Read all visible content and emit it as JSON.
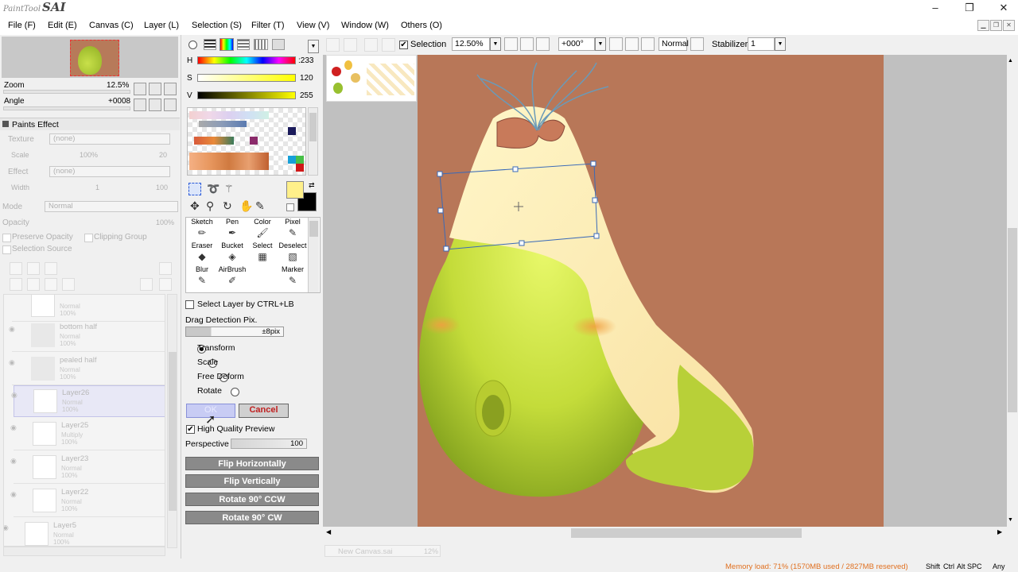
{
  "app": {
    "logo_small": "PaintTool",
    "logo_big": "SAI",
    "window_min": "–",
    "window_restore": "❐",
    "window_close": "✕"
  },
  "menu": [
    "File (F)",
    "Edit (E)",
    "Canvas (C)",
    "Layer (L)",
    "Selection (S)",
    "Filter (T)",
    "View (V)",
    "Window (W)",
    "Others (O)"
  ],
  "navigator": {
    "zoom_label": "Zoom",
    "zoom_value": "12.5%",
    "angle_label": "Angle",
    "angle_value": "+0008"
  },
  "paints_effect": {
    "header": "Paints Effect",
    "texture_label": "Texture",
    "texture_value": "(none)",
    "scale_label": "Scale",
    "scale_value": "100%",
    "scale_num": "20",
    "effect_label": "Effect",
    "effect_value": "(none)",
    "width_label": "Width",
    "width_value": "1",
    "width_num": "100",
    "mode_label": "Mode",
    "mode_value": "Normal",
    "opacity_label": "Opacity",
    "opacity_value": "100%",
    "preserve_opacity": "Preserve Opacity",
    "clipping_group": "Clipping Group",
    "selection_source": "Selection Source"
  },
  "layers": [
    {
      "name": "",
      "mode": "Normal",
      "opacity": "100%"
    },
    {
      "name": "bottom half",
      "mode": "Normal",
      "opacity": "100%"
    },
    {
      "name": "pealed half",
      "mode": "Normal",
      "opacity": "100%"
    },
    {
      "name": "Layer26",
      "mode": "Normal",
      "opacity": "100%"
    },
    {
      "name": "Layer25",
      "mode": "Multiply",
      "opacity": "100%"
    },
    {
      "name": "Layer23",
      "mode": "Normal",
      "opacity": "100%"
    },
    {
      "name": "Layer22",
      "mode": "Normal",
      "opacity": "100%"
    },
    {
      "name": "Layer5",
      "mode": "Normal",
      "opacity": "100%"
    }
  ],
  "color": {
    "h_label": "H",
    "h_value": ":233",
    "s_label": "S",
    "s_value": "120",
    "v_label": "V",
    "v_value": "255",
    "fg": "#fff08a",
    "bg": "#000000"
  },
  "tools": [
    {
      "label": "Sketch",
      "icon": "pencil-icon"
    },
    {
      "label": "Pen",
      "icon": "pen-icon"
    },
    {
      "label": "Color",
      "icon": "brush-icon"
    },
    {
      "label": "Pixel",
      "icon": "pixel-pen-icon"
    },
    {
      "label": "Eraser",
      "icon": "eraser-icon"
    },
    {
      "label": "Bucket",
      "icon": "bucket-icon"
    },
    {
      "label": "Select",
      "icon": "select-icon"
    },
    {
      "label": "Deselect",
      "icon": "deselect-icon"
    },
    {
      "label": "Blur",
      "icon": "blur-icon"
    },
    {
      "label": "AirBrush",
      "icon": "airbrush-icon"
    },
    {
      "label": "",
      "icon": ""
    },
    {
      "label": "Marker",
      "icon": "marker-icon"
    }
  ],
  "transform": {
    "select_layer_ctrl": "Select Layer by CTRL+LB",
    "drag_detection": "Drag Detection Pix.",
    "drag_value": "±8pix",
    "opt_transform": "Transform",
    "opt_scale": "Scale",
    "opt_free": "Free Deform",
    "opt_rotate": "Rotate",
    "ok": "OK",
    "cancel": "Cancel",
    "hq_preview": "High Quality Preview",
    "perspective": "Perspective",
    "perspective_value": "100",
    "flip_h": "Flip Horizontally",
    "flip_v": "Flip Vertically",
    "rot_ccw": "Rotate 90° CCW",
    "rot_cw": "Rotate 90° CW"
  },
  "options": {
    "selection_label": "Selection",
    "zoom": "12.50%",
    "angle": "+000°",
    "blend": "Normal",
    "stabilizer_label": "Stabilizer",
    "stabilizer_value": "1"
  },
  "canvas_tab": {
    "name": "New Canvas.sai",
    "zoom": "12%"
  },
  "status": {
    "memory": "Memory load: 71% (1570MB used / 2827MB reserved)",
    "keys": [
      "Shift",
      "Ctrl",
      "Alt",
      "SPC",
      "Any"
    ]
  }
}
